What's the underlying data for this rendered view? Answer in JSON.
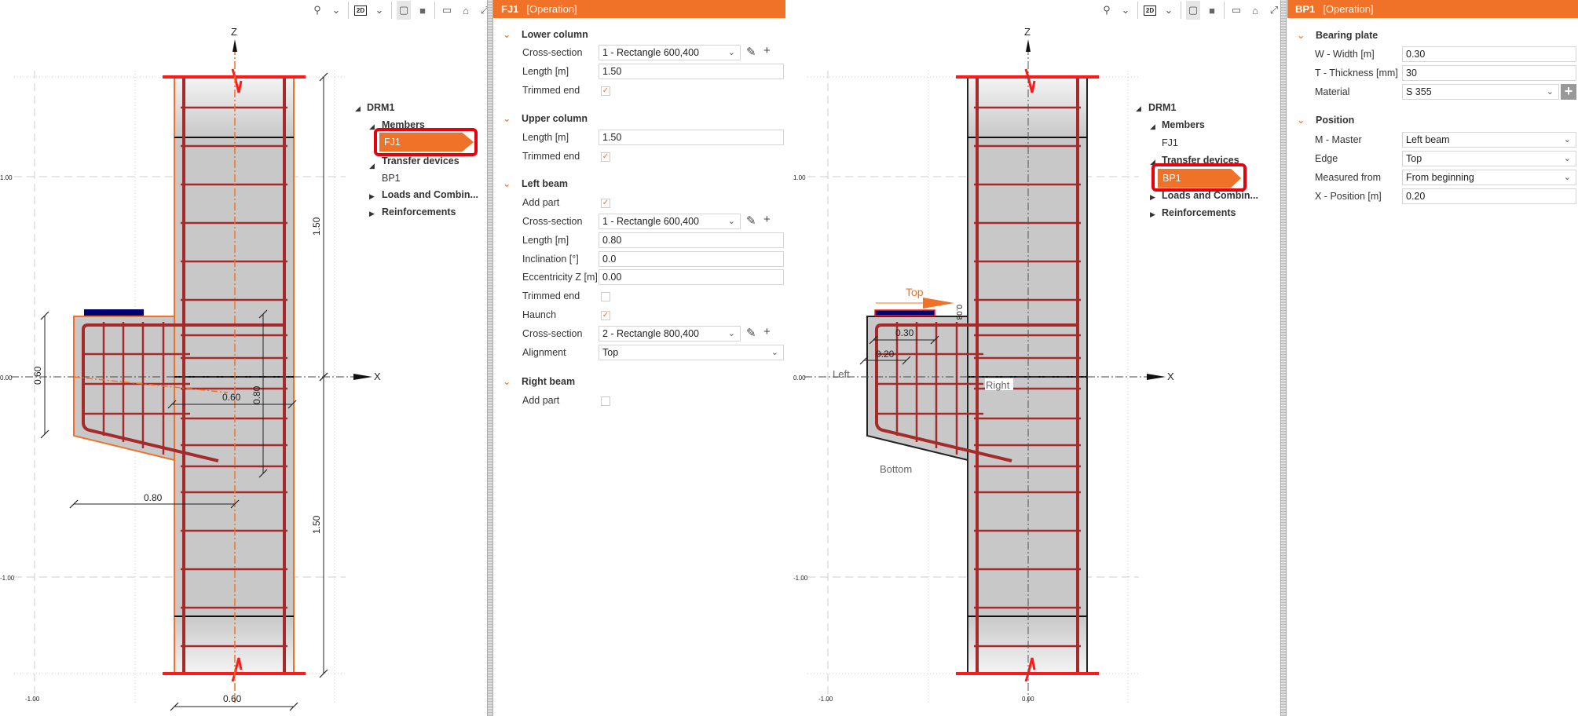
{
  "colors": {
    "accent": "#f07228",
    "selection_outline": "#e8000b",
    "rebar": "#a52a2a",
    "concrete": "#c8c8c8",
    "plate": "#000070"
  },
  "toolbar": {
    "icons": [
      "search-icon",
      "chevron-down-icon",
      "2d-view-icon",
      "chevron-down-icon",
      "wireframe-icon",
      "solid-icon",
      "box-icon",
      "home-icon",
      "fullscreen-icon"
    ],
    "view_mode": "2D"
  },
  "axes": {
    "z": "Z",
    "x": "X",
    "grid": {
      "plus_one": "1.00",
      "zero": "0.00",
      "minus_one": "-1.00"
    }
  },
  "viewport1": {
    "dims": {
      "beam_depth": "0.60",
      "beam_length": "0.80",
      "col_half": "0.60",
      "haunch_depth": "0.80",
      "upper_len": "1.50",
      "lower_len": "1.50",
      "col_width": "0.60"
    }
  },
  "viewport2": {
    "labels": {
      "top": "Top",
      "left": "Left",
      "right": "Right",
      "bottom": "Bottom"
    },
    "dims": {
      "plate_width": "0.30",
      "plate_pos": "0.20",
      "plate_thk": "0.03"
    },
    "bottom_tick": "0.00"
  },
  "tree": {
    "root": "DRM1",
    "members": "Members",
    "fj1": "FJ1",
    "transfer": "Transfer devices",
    "bp1": "BP1",
    "loads": "Loads and Combin...",
    "reinf": "Reinforcements"
  },
  "panel1": {
    "title": "FJ1",
    "mode": "[Operation]",
    "lower": {
      "title": "Lower column",
      "cs_label": "Cross-section",
      "cs": "1 - Rectangle 600,400",
      "len_label": "Length [m]",
      "len": "1.50",
      "trim_label": "Trimmed end",
      "trim": true
    },
    "upper": {
      "title": "Upper column",
      "len_label": "Length [m]",
      "len": "1.50",
      "trim_label": "Trimmed end",
      "trim": true
    },
    "left": {
      "title": "Left beam",
      "add_label": "Add part",
      "add": true,
      "cs_label": "Cross-section",
      "cs": "1 - Rectangle 600,400",
      "len_label": "Length [m]",
      "len": "0.80",
      "incl_label": "Inclination [°]",
      "incl": "0.0",
      "ecc_label": "Eccentricity Z [m]",
      "ecc": "0.00",
      "trim_label": "Trimmed end",
      "trim": false,
      "haunch_label": "Haunch",
      "haunch": true,
      "hcs_label": "Cross-section",
      "hcs": "2 - Rectangle 800,400",
      "align_label": "Alignment",
      "align": "Top"
    },
    "right": {
      "title": "Right beam",
      "add_label": "Add part",
      "add": false
    }
  },
  "panel2": {
    "title": "BP1",
    "mode": "[Operation]",
    "plate": {
      "title": "Bearing plate",
      "w_label": "W - Width [m]",
      "w": "0.30",
      "t_label": "T - Thickness [mm]",
      "t": "30",
      "mat_label": "Material",
      "mat": "S 355"
    },
    "pos": {
      "title": "Position",
      "m_label": "M - Master",
      "m": "Left beam",
      "edge_label": "Edge",
      "edge": "Top",
      "meas_label": "Measured from",
      "meas": "From beginning",
      "x_label": "X - Position [m]",
      "x": "0.20"
    }
  }
}
